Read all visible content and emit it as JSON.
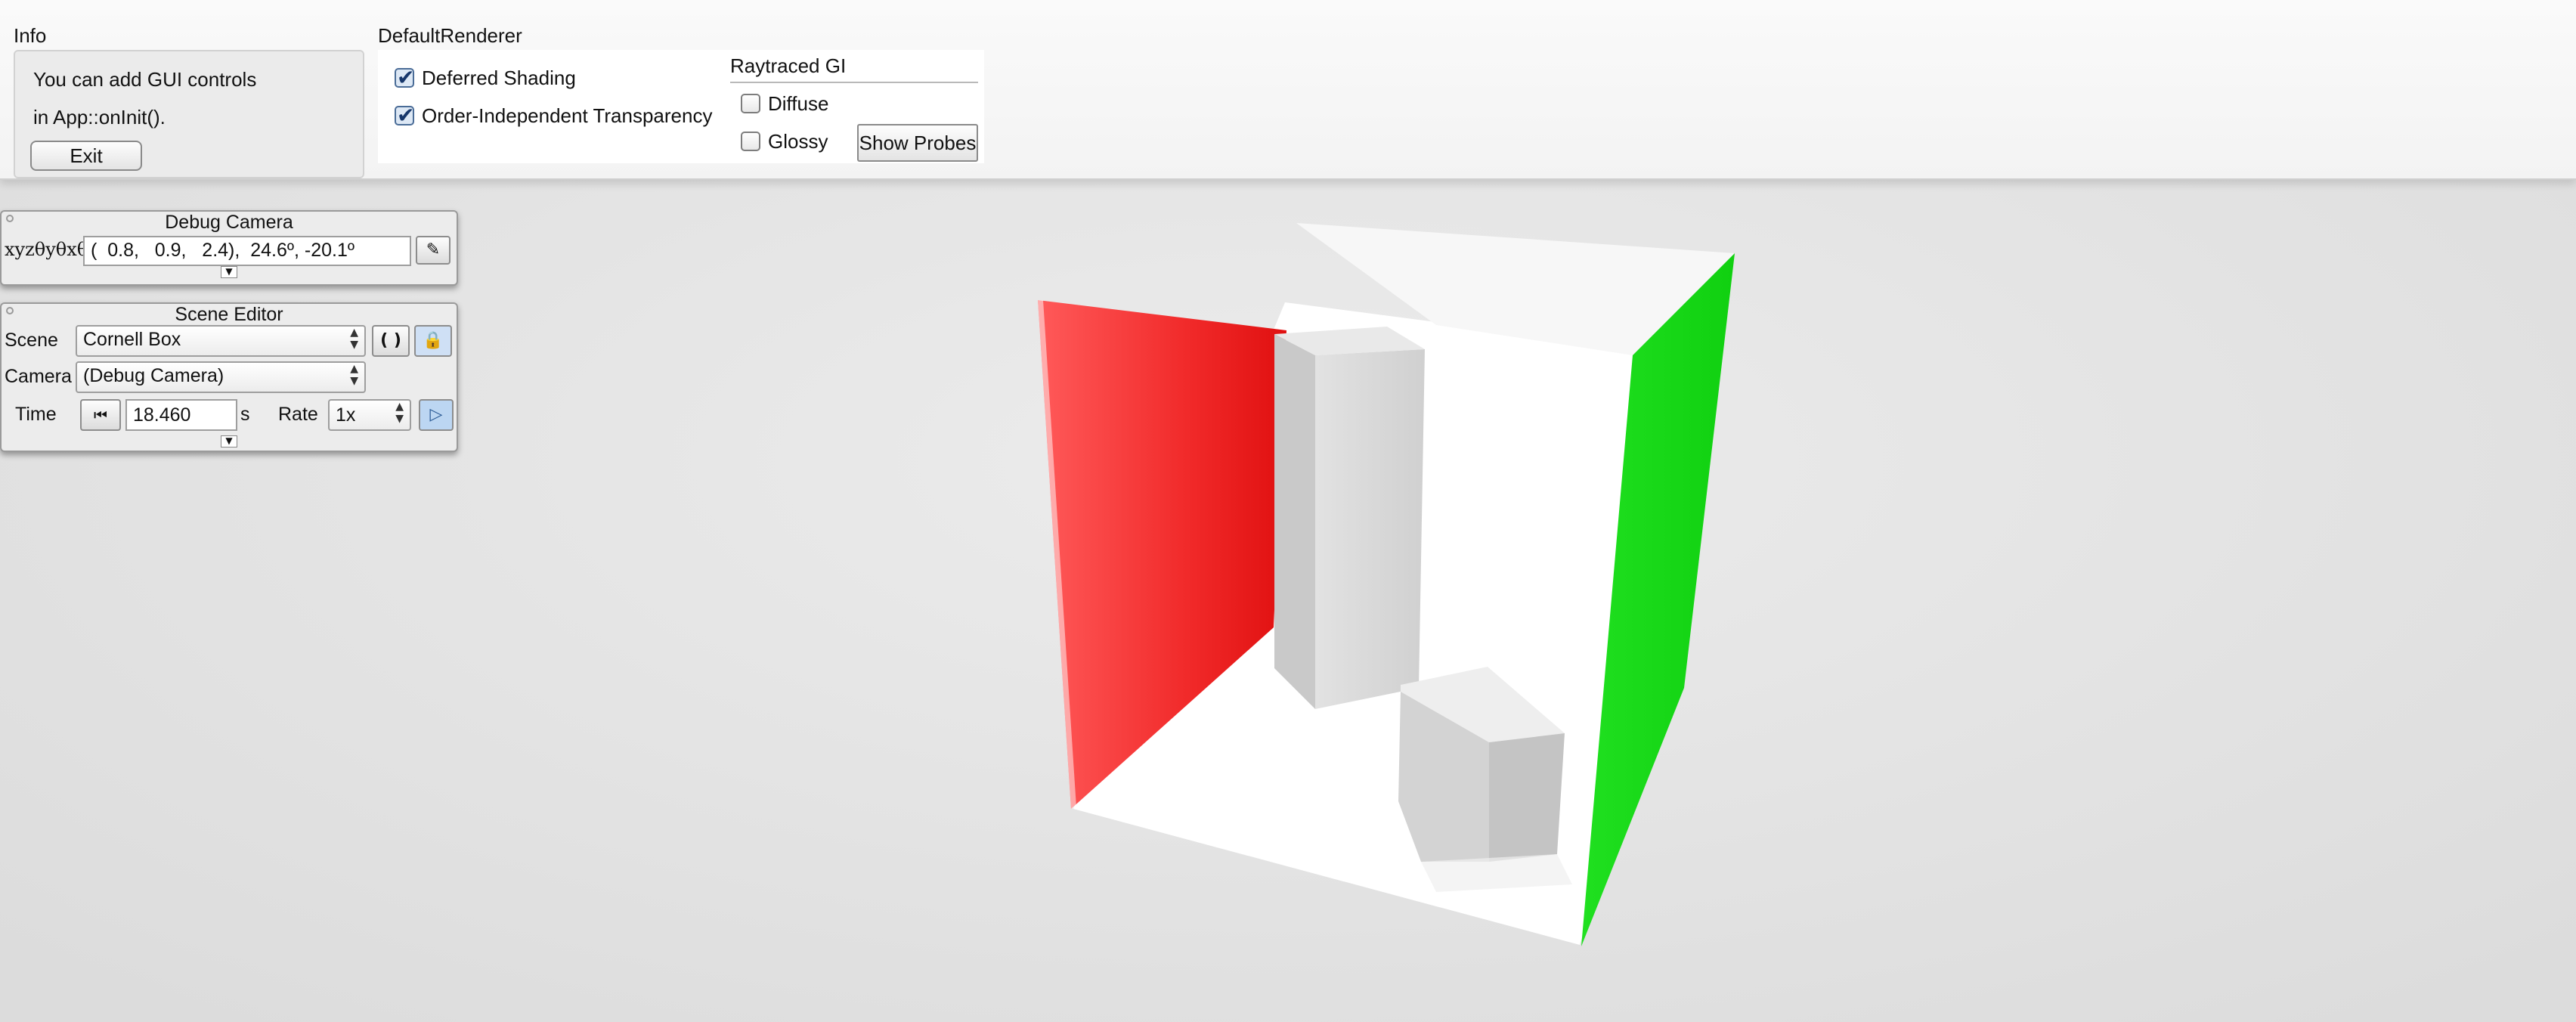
{
  "info": {
    "title": "Info",
    "line1": "You can add GUI controls",
    "line2": "in App::onInit().",
    "exit_label": "Exit"
  },
  "renderer": {
    "title": "DefaultRenderer",
    "deferred_label": "Deferred Shading",
    "deferred_checked": true,
    "oit_label": "Order-Independent Transparency",
    "oit_checked": true,
    "gi_title": "Raytraced GI",
    "diffuse_label": "Diffuse",
    "diffuse_checked": false,
    "glossy_label": "Glossy",
    "glossy_checked": false,
    "show_probes_label": "Show Probes"
  },
  "debug_camera": {
    "title": "Debug Camera",
    "coord_label": "xyzθyθxθz",
    "value": "(  0.8,   0.9,   2.4),  24.6º, -20.1º",
    "edit_icon": "pencil-icon"
  },
  "scene_editor": {
    "title": "Scene Editor",
    "scene_label": "Scene",
    "scene_value": "Cornell Box",
    "camera_label": "Camera",
    "camera_value": "(Debug Camera)",
    "time_label": "Time",
    "time_value": "18.460",
    "time_unit": "s",
    "rate_label": "Rate",
    "rate_value": "1x",
    "reload_icon": "reload-icon",
    "lock_icon": "lock-icon",
    "reset_icon": "rewind-icon",
    "play_icon": "play-icon"
  },
  "scene_colors": {
    "background": "#e6e6e6",
    "left_wall": "#e8141b",
    "right_wall": "#17dc17",
    "boxes": "#d6d6d6"
  }
}
